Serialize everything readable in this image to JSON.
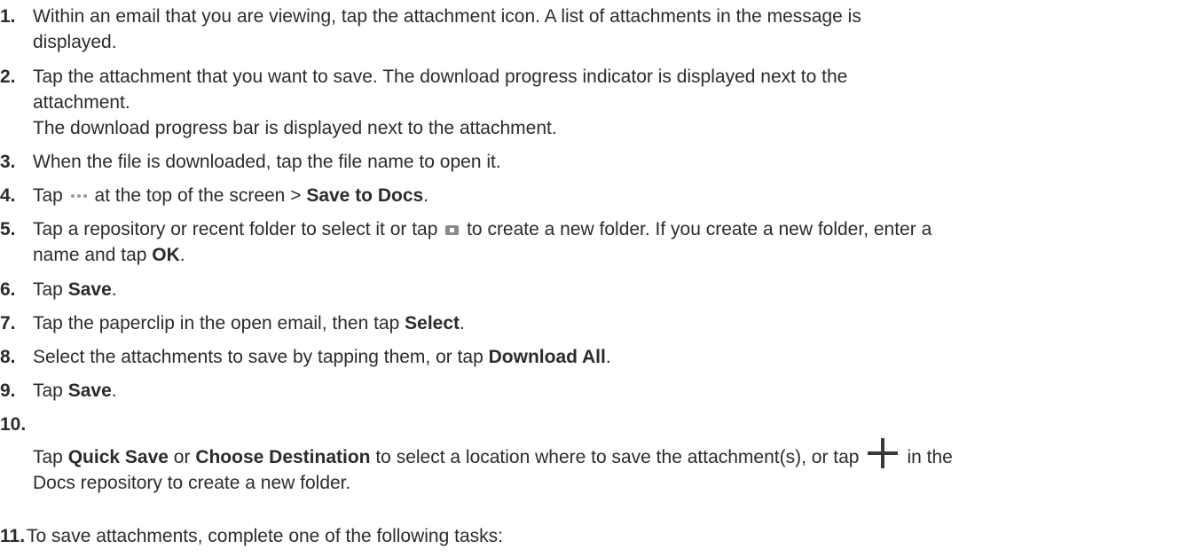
{
  "steps": [
    {
      "num": "1.",
      "lines": [
        "Within an email that you are viewing, tap the attachment icon. A list of attachments in the message is",
        "displayed."
      ]
    },
    {
      "num": "2.",
      "lines": [
        "Tap the attachment that you want to save. The download progress indicator is displayed next to the",
        "attachment.",
        "The download progress bar is displayed next to the attachment."
      ]
    },
    {
      "num": "3.",
      "text": "When the file is downloaded, tap the file name to open it."
    },
    {
      "num": "4.",
      "pre": "Tap",
      "icon": "more-dots-icon",
      "post": "at the top of the screen >",
      "bold": "Save to Docs",
      "end": "."
    },
    {
      "num": "5.",
      "line1_pre": "Tap a repository or recent folder to select it or tap",
      "icon": "new-folder-icon",
      "line1_post": "to create a new folder. If you create a new folder, enter a",
      "line2_pre": "name and tap",
      "bold": "OK",
      "end": "."
    },
    {
      "num": "6.",
      "pre": "Tap",
      "bold": "Save",
      "end": "."
    },
    {
      "num": "7.",
      "pre": "Tap the paperclip in the open email, then tap",
      "bold": "Select",
      "end": "."
    },
    {
      "num": "8.",
      "pre": "Select the attachments to save by tapping them, or tap",
      "bold": "Download All",
      "end": "."
    },
    {
      "num": "9.",
      "pre": "Tap",
      "bold": "Save",
      "end": "."
    },
    {
      "num": "10.",
      "pre": "Tap",
      "bold1": "Quick Save",
      "mid": "or",
      "bold2": "Choose Destination",
      "post": "to select a location where to save the attachment(s), or tap",
      "icon": "plus-icon",
      "post2": "in the",
      "line2": "Docs repository to create a new folder."
    },
    {
      "num": "11.",
      "text": "To save attachments, complete one of the following tasks:"
    }
  ]
}
